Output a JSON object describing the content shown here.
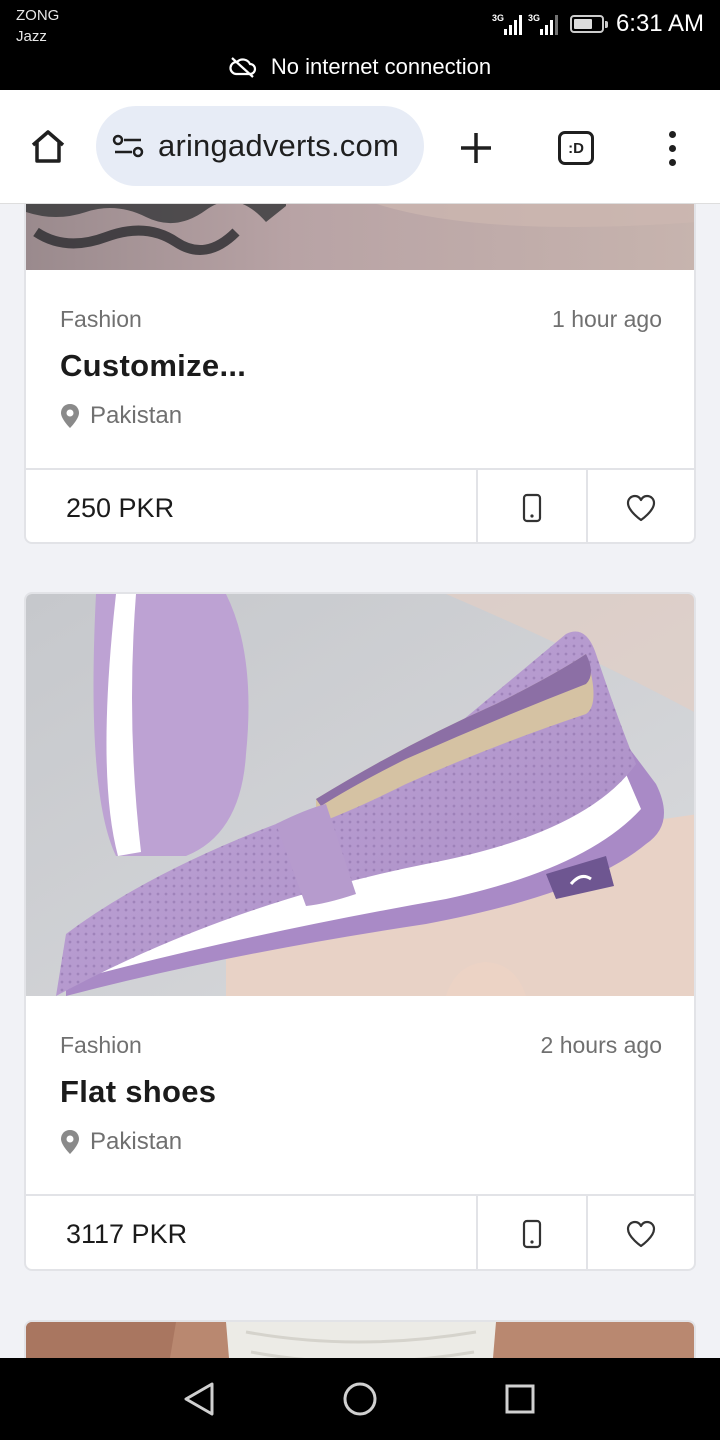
{
  "status_bar": {
    "carrier_1": "ZONG",
    "carrier_2": "Jazz",
    "network_1": "3G",
    "network_2": "3G",
    "battery_level": 0.7,
    "time": "6:31 AM",
    "banner": "No internet connection"
  },
  "browser": {
    "url": "aringadverts.com",
    "tabs_label": ":D"
  },
  "listings": [
    {
      "category": "Fashion",
      "time_ago": "1 hour ago",
      "title": "Customize...",
      "location": "Pakistan",
      "price": "250 PKR"
    },
    {
      "category": "Fashion",
      "time_ago": "2 hours ago",
      "title": "Flat shoes",
      "location": "Pakistan",
      "price": "3117 PKR"
    }
  ],
  "colors": {
    "page_background": "#f1f2f6",
    "url_pill": "#e7ecf6",
    "shoe_purple": "#b89ed0"
  }
}
